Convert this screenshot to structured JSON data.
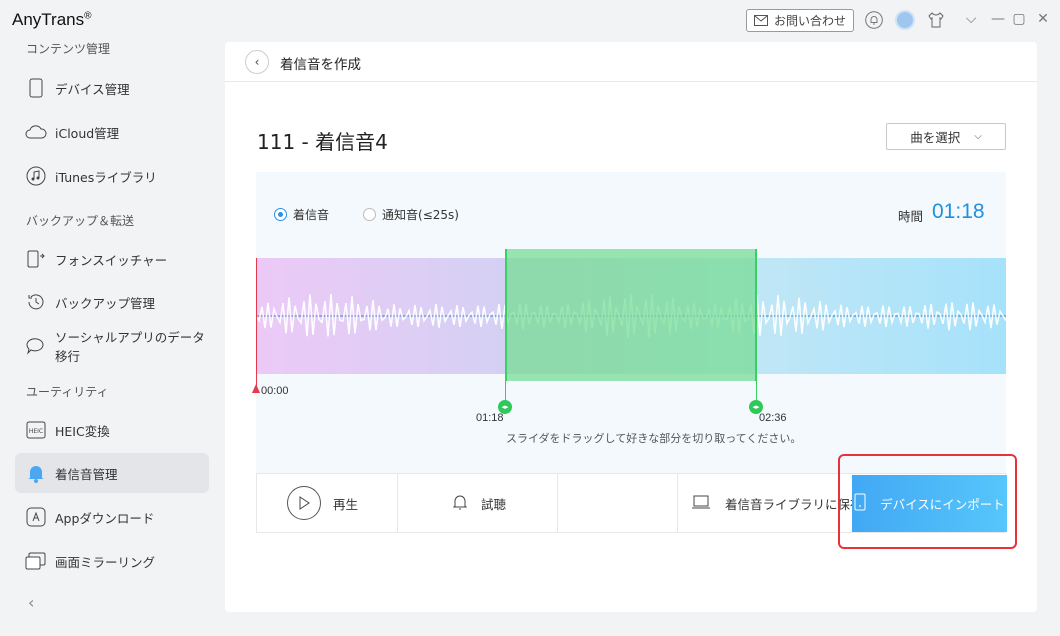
{
  "app": {
    "title": "AnyTrans",
    "title_mark": "®"
  },
  "titlebar": {
    "contact_label": "お問い合わせ"
  },
  "sidebar": {
    "section_content": "コンテンツ管理",
    "section_backup": "バックアップ＆転送",
    "section_utility": "ユーティリティ",
    "items": [
      {
        "label": "デバイス管理",
        "icon": "phone-icon"
      },
      {
        "label": "iCloud管理",
        "icon": "cloud-icon"
      },
      {
        "label": "iTunesライブラリ",
        "icon": "music-icon"
      },
      {
        "label": "フォンスイッチャー",
        "icon": "phone-switch-icon"
      },
      {
        "label": "バックアップ管理",
        "icon": "history-icon"
      },
      {
        "label": "ソーシャルアプリのデータ移行",
        "icon": "chat-icon"
      },
      {
        "label": "HEIC変換",
        "icon": "heic-icon"
      },
      {
        "label": "着信音管理",
        "icon": "bell-icon",
        "active": true
      },
      {
        "label": "Appダウンロード",
        "icon": "app-store-icon"
      },
      {
        "label": "画面ミラーリング",
        "icon": "mirror-icon"
      }
    ],
    "collapse_glyph": "‹"
  },
  "main": {
    "header_title": "着信音を作成",
    "song_title": "111 - 着信音4",
    "select_song_label": "曲を選択",
    "ringtone_option": "着信音",
    "notification_option": "通知音(≤25s)",
    "selected_option": "ringtone",
    "time_label": "時間",
    "time_value": "01:18",
    "start_time": "00:00",
    "selection_start": "01:18",
    "selection_end": "02:36",
    "hint": "スライダをドラッグして好きな部分を切り取ってください。",
    "play_label": "再生",
    "preview_label": "試聴",
    "save_library_label": "着信音ライブラリに保存",
    "import_label": "デバイスにインポート"
  },
  "colors": {
    "accent": "#1f8fe0",
    "selection": "#38d060",
    "playhead": "#e43a4d",
    "highlight": "#e8323a"
  }
}
